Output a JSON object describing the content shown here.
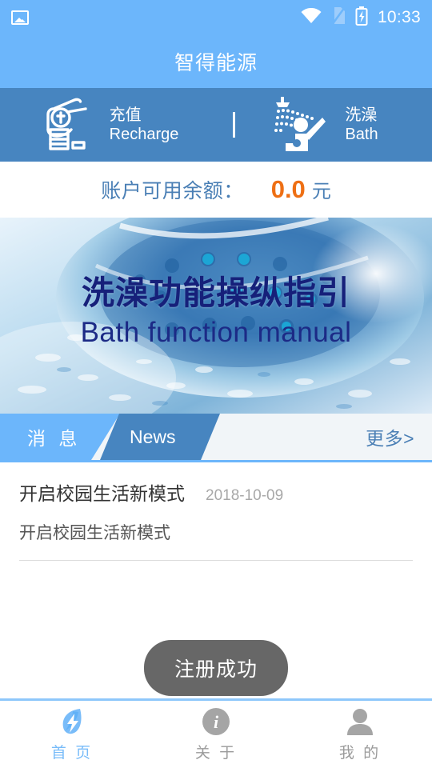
{
  "status_bar": {
    "left_icon": "image-icon",
    "wifi_icon": "wifi-icon",
    "signal_icon": "no-sim-icon",
    "battery_icon": "battery-charging-icon",
    "time": "10:33"
  },
  "header": {
    "title": "智得能源"
  },
  "actions": [
    {
      "icon": "hand-coin-recharge-icon",
      "cn": "充值",
      "en": "Recharge"
    },
    {
      "icon": "shower-person-icon",
      "cn": "洗澡",
      "en": "Bath"
    }
  ],
  "balance": {
    "label": "账户可用余额：",
    "value": "0.0",
    "unit": "元",
    "value_color": "#ee6f14",
    "label_color": "#4a7fb5"
  },
  "banner": {
    "title_cn": "洗澡功能操纵指引",
    "title_en": "Bath function manual",
    "image": "shower-head-water-photo"
  },
  "news_header": {
    "tab_cn": "消 息",
    "tab_en": "News",
    "more": "更多>"
  },
  "news_items": [
    {
      "title": "开启校园生活新模式",
      "date": "2018-10-09",
      "summary": "开启校园生活新模式"
    }
  ],
  "toast": {
    "message": "注册成功"
  },
  "bottom_nav": [
    {
      "icon": "leaf-bolt-home-icon",
      "label": "首 页",
      "active": true
    },
    {
      "icon": "info-circle-icon",
      "label": "关 于",
      "active": false
    },
    {
      "icon": "person-icon",
      "label": "我 的",
      "active": false
    }
  ],
  "colors": {
    "header_blue": "#6cb6fb",
    "action_blue": "#4785c0",
    "accent_orange": "#ee6f14",
    "text_blue": "#4a7fb5"
  }
}
